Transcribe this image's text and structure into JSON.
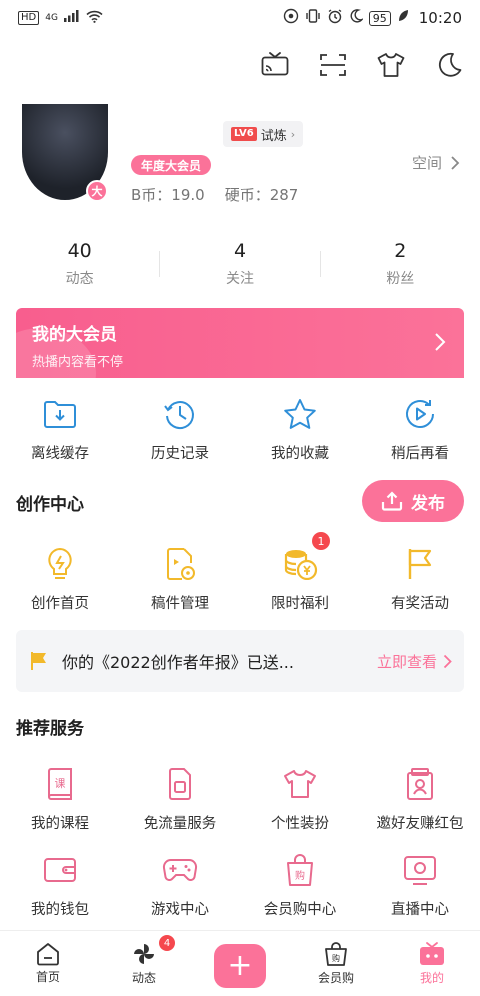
{
  "status_bar": {
    "left_badges": [
      "HD",
      "4G"
    ],
    "battery": "95",
    "time": "10:20"
  },
  "top_icons": [
    "tv-cast-icon",
    "scan-icon",
    "tshirt-icon",
    "moon-icon"
  ],
  "profile": {
    "level_label": "LV6",
    "level_action": "试炼",
    "avatar_badge": "大",
    "vip_tag": "年度大会员",
    "coins": [
      {
        "label": "B币：",
        "value": "19.0"
      },
      {
        "label": "硬币：",
        "value": "287"
      }
    ],
    "space_link": "空间"
  },
  "stats": [
    {
      "value": "40",
      "label": "动态"
    },
    {
      "value": "4",
      "label": "关注"
    },
    {
      "value": "2",
      "label": "粉丝"
    }
  ],
  "vip_banner": {
    "title": "我的大会员",
    "subtitle": "热播内容看不停"
  },
  "quick_actions": [
    {
      "icon": "download-folder-icon",
      "label": "离线缓存"
    },
    {
      "icon": "history-clock-icon",
      "label": "历史记录"
    },
    {
      "icon": "star-icon",
      "label": "我的收藏"
    },
    {
      "icon": "watch-later-icon",
      "label": "稍后再看"
    }
  ],
  "creation": {
    "title": "创作中心",
    "publish_label": "发布",
    "items": [
      {
        "icon": "bulb-icon",
        "label": "创作首页",
        "badge": ""
      },
      {
        "icon": "draft-file-icon",
        "label": "稿件管理",
        "badge": ""
      },
      {
        "icon": "coins-icon",
        "label": "限时福利",
        "badge": "1"
      },
      {
        "icon": "flag-icon",
        "label": "有奖活动",
        "badge": ""
      }
    ]
  },
  "notice": {
    "text": "你的《2022创作者年报》已送...",
    "link": "立即查看"
  },
  "services": {
    "title": "推荐服务",
    "items": [
      {
        "icon": "course-book-icon",
        "label": "我的课程"
      },
      {
        "icon": "sim-card-icon",
        "label": "免流量服务"
      },
      {
        "icon": "tshirt-icon",
        "label": "个性装扮"
      },
      {
        "icon": "invite-gift-icon",
        "label": "邀好友赚红包"
      },
      {
        "icon": "wallet-icon",
        "label": "我的钱包"
      },
      {
        "icon": "gamepad-icon",
        "label": "游戏中心"
      },
      {
        "icon": "shopping-bag-icon",
        "label": "会员购中心"
      },
      {
        "icon": "live-tv-icon",
        "label": "直播中心"
      }
    ]
  },
  "tabbar": [
    {
      "icon": "home-icon",
      "label": "首页"
    },
    {
      "icon": "pinwheel-icon",
      "label": "动态",
      "badge": "4"
    },
    {
      "icon": "plus-icon",
      "label": ""
    },
    {
      "icon": "shop-bag-icon",
      "label": "会员购"
    },
    {
      "icon": "tv-mine-icon",
      "label": "我的"
    }
  ],
  "colors": {
    "accent": "#fb7299",
    "icon_blue": "#2f8fd8",
    "icon_yellow": "#f2b92b",
    "badge_red": "#f5484e"
  }
}
